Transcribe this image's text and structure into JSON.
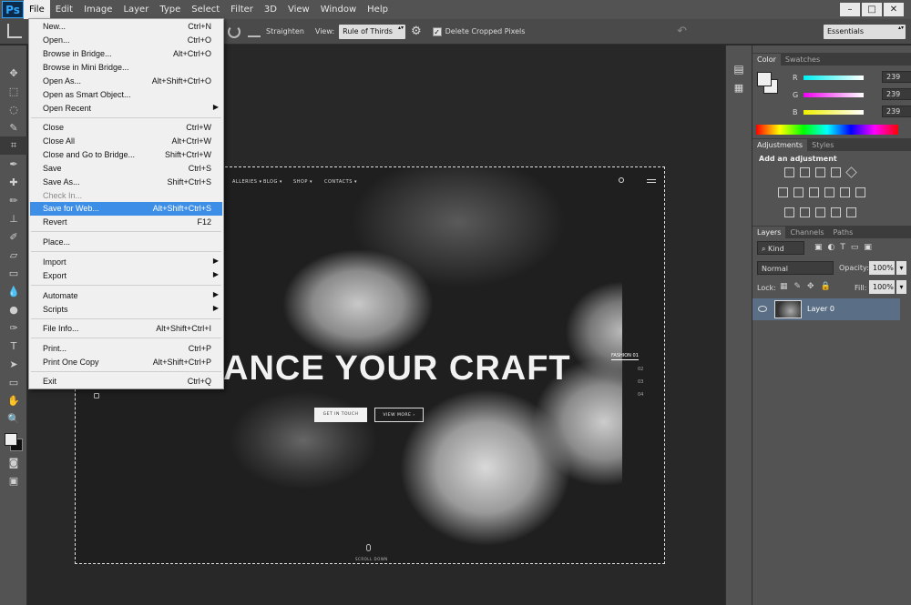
{
  "app": {
    "logo": "Ps"
  },
  "menubar": [
    "File",
    "Edit",
    "Image",
    "Layer",
    "Type",
    "Select",
    "Filter",
    "3D",
    "View",
    "Window",
    "Help"
  ],
  "window_controls": [
    "–",
    "□",
    "✕"
  ],
  "options_bar": {
    "straighten_label": "Straighten",
    "view_label": "View:",
    "view_value": "Rule of Thirds",
    "delete_cropped_label": "Delete Cropped Pixels",
    "workspace": "Essentials"
  },
  "file_menu": {
    "items": [
      {
        "label": "New...",
        "shortcut": "Ctrl+N"
      },
      {
        "label": "Open...",
        "shortcut": "Ctrl+O"
      },
      {
        "label": "Browse in Bridge...",
        "shortcut": "Alt+Ctrl+O"
      },
      {
        "label": "Browse in Mini Bridge...",
        "shortcut": ""
      },
      {
        "label": "Open As...",
        "shortcut": "Alt+Shift+Ctrl+O"
      },
      {
        "label": "Open as Smart Object...",
        "shortcut": ""
      },
      {
        "label": "Open Recent",
        "shortcut": ""
      },
      {
        "label": "Close",
        "shortcut": "Ctrl+W"
      },
      {
        "label": "Close All",
        "shortcut": "Alt+Ctrl+W"
      },
      {
        "label": "Close and Go to Bridge...",
        "shortcut": "Shift+Ctrl+W"
      },
      {
        "label": "Save",
        "shortcut": "Ctrl+S"
      },
      {
        "label": "Save As...",
        "shortcut": "Shift+Ctrl+S"
      },
      {
        "label": "Check In...",
        "shortcut": ""
      },
      {
        "label": "Save for Web...",
        "shortcut": "Alt+Shift+Ctrl+S"
      },
      {
        "label": "Revert",
        "shortcut": "F12"
      },
      {
        "label": "Place...",
        "shortcut": ""
      },
      {
        "label": "Import",
        "shortcut": ""
      },
      {
        "label": "Export",
        "shortcut": ""
      },
      {
        "label": "Automate",
        "shortcut": ""
      },
      {
        "label": "Scripts",
        "shortcut": ""
      },
      {
        "label": "File Info...",
        "shortcut": "Alt+Shift+Ctrl+I"
      },
      {
        "label": "Print...",
        "shortcut": "Ctrl+P"
      },
      {
        "label": "Print One Copy",
        "shortcut": "Alt+Shift+Ctrl+P"
      },
      {
        "label": "Exit",
        "shortcut": "Ctrl+Q"
      }
    ]
  },
  "document": {
    "nav": [
      "ALLERIES ▾",
      "BLOG ▾",
      "SHOP ▾",
      "CONTACTS ▾"
    ],
    "hero_title": "ANCE YOUR CRAFT",
    "btn_primary": "GET IN TOUCH",
    "btn_secondary": "VIEW MORE ›",
    "slides": [
      {
        "label": "FASHION",
        "num": "01"
      },
      {
        "label": "",
        "num": "02"
      },
      {
        "label": "",
        "num": "03"
      },
      {
        "label": "",
        "num": "04"
      }
    ],
    "scroll": "SCROLL DOWN"
  },
  "color_panel": {
    "tabs": [
      "Color",
      "Swatches"
    ],
    "r_label": "R",
    "r": "239",
    "g_label": "G",
    "g": "239",
    "b_label": "B",
    "b": "239"
  },
  "adjustments_panel": {
    "tabs": [
      "Adjustments",
      "Styles"
    ],
    "heading": "Add an adjustment"
  },
  "layers_panel": {
    "tabs": [
      "Layers",
      "Channels",
      "Paths"
    ],
    "kind": "Kind",
    "blend_mode": "Normal",
    "opacity_label": "Opacity:",
    "opacity": "100%",
    "lock_label": "Lock:",
    "fill_label": "Fill:",
    "fill": "100%",
    "layer_name": "Layer 0"
  },
  "colors": {
    "highlight": "#3d8ee6",
    "chrome": "#535353",
    "selected_layer": "#5a6e85"
  }
}
